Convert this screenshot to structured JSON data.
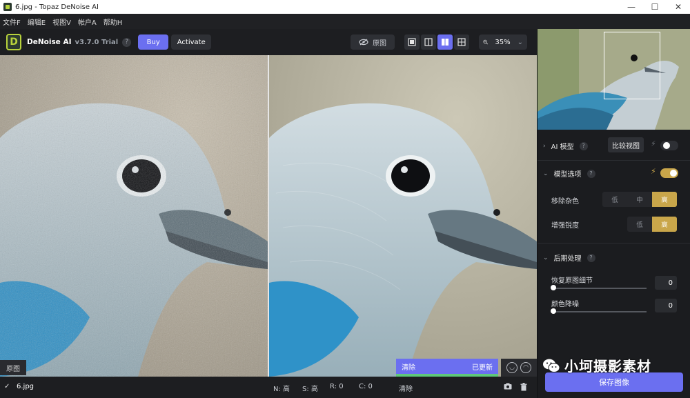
{
  "window": {
    "title": "6.jpg - Topaz DeNoise AI",
    "controls": [
      "—",
      "☐",
      "✕"
    ]
  },
  "menu": [
    "文件F",
    "编辑E",
    "视图V",
    "帐户A",
    "帮助H"
  ],
  "toolbar": {
    "logo_letter": "D",
    "product": "DeNoise AI",
    "version": "v3.7.0 Trial",
    "help": "?",
    "buy": "Buy",
    "activate": "Activate",
    "original": "原图",
    "zoom": "35%",
    "zoom_caret": "⌄"
  },
  "canvas": {
    "original_label": "原图",
    "processing": {
      "left": "清除",
      "right": "已更新",
      "progress": 1.0
    }
  },
  "statusbar": {
    "check": "✓",
    "filename": "6.jpg",
    "noise": "N: 高",
    "sharpen": "S: 高",
    "recover": "R: 0",
    "color": "C: 0",
    "clear": "清除"
  },
  "panel": {
    "ai_model": {
      "chev": "›",
      "title": "AI 模型",
      "q": "?",
      "compare": "比较视图",
      "bolt": "⚡",
      "toggle_on": false
    },
    "model_options": {
      "chev": "⌄",
      "title": "模型选项",
      "q": "?",
      "bolt": "⚡",
      "toggle_on": true
    },
    "remove_noise": {
      "label": "移除杂色",
      "options": [
        "低",
        "中",
        "高"
      ],
      "selected": "高"
    },
    "enhance_sharpness": {
      "label": "增强锐度",
      "options": [
        "低",
        "高"
      ],
      "selected": "高"
    },
    "post_processing": {
      "chev": "⌄",
      "title": "后期处理",
      "q": "?"
    },
    "recover_detail": {
      "label": "恢复原图细节",
      "value": "0"
    },
    "color_noise": {
      "label": "颜色降噪",
      "value": "0"
    },
    "save": "保存图像"
  },
  "watermark": {
    "brand": "小坷摄影素材"
  },
  "colors": {
    "accent": "#6b6ff0",
    "gold": "#c9a64a",
    "progress": "#5ec87a"
  }
}
